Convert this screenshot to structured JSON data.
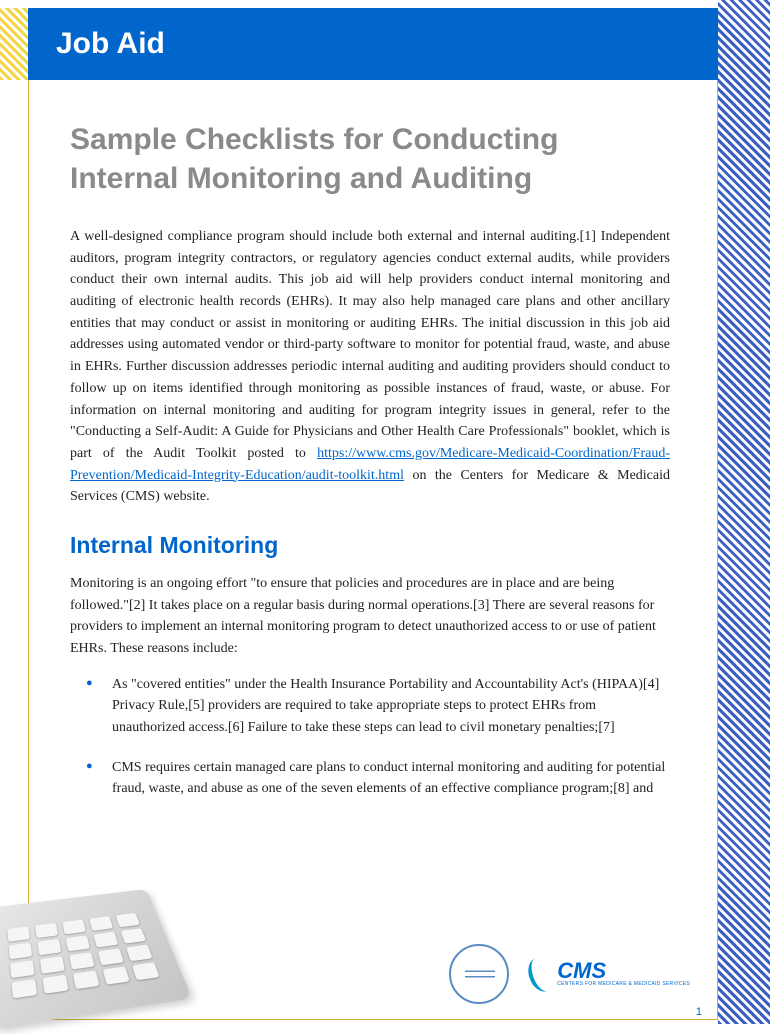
{
  "header": {
    "label": "Job Aid"
  },
  "title": "Sample Checklists for Conducting Internal Monitoring and Auditing",
  "intro": {
    "part1": "A well-designed compliance program should include both external and internal auditing.[1] Independent auditors, program integrity contractors, or regulatory agencies conduct external audits, while providers conduct their own internal audits. This job aid will help providers conduct internal monitoring and auditing of electronic health records (EHRs). It may also help managed care plans and other ancillary entities that may conduct or assist in monitoring or auditing EHRs. The initial discussion in this job aid addresses using automated vendor or third-party software to monitor for potential fraud, waste, and abuse in EHRs. Further discussion addresses periodic internal auditing and auditing providers should conduct to follow up on items identified through monitoring as possible instances of fraud, waste, or abuse. For information on internal monitoring and auditing for program integrity issues in general, refer to the \"Conducting a Self-Audit: A Guide for Physicians and Other Health Care Professionals\" booklet, which is part of the Audit Toolkit posted to ",
    "link": "https://www.cms.gov/Medicare-Medicaid-Coordination/Fraud-Prevention/Medicaid-Integrity-Education/audit-toolkit.html",
    "part2": " on the Centers for Medicare & Medicaid Services (CMS) website."
  },
  "section": {
    "heading": "Internal Monitoring",
    "body": "Monitoring is an ongoing effort \"to ensure that policies and procedures are in place and are being followed.\"[2] It takes place on a regular basis during normal operations.[3] There are several reasons for providers to implement an internal monitoring program to detect unauthorized access to or use of patient EHRs. These reasons include:",
    "bullets": [
      "As \"covered entities\" under the Health Insurance Portability and Accountability Act's (HIPAA)[4] Privacy Rule,[5] providers are required to take appropriate steps to protect EHRs from unauthorized access.[6] Failure to take these steps can lead to civil monetary penalties;[7]",
      "CMS requires certain managed care plans to conduct internal monitoring and auditing for potential fraud, waste, and abuse as one of the seven elements of an effective compliance program;[8] and"
    ]
  },
  "logos": {
    "cms_text": "CMS",
    "cms_sub": "CENTERS FOR MEDICARE & MEDICAID SERVICES"
  },
  "page_number": "1"
}
